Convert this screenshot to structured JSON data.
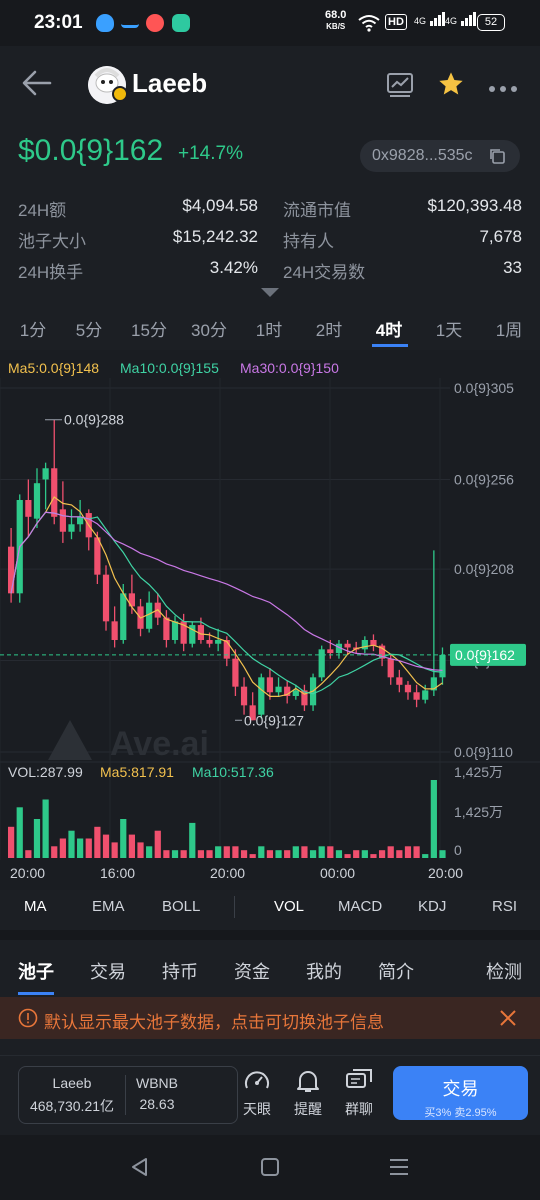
{
  "status": {
    "time": "23:01",
    "net_speed": "68.0",
    "net_unit": "KB/S",
    "hd": "HD",
    "sig1": "4G",
    "sig2": "4G",
    "battery": "52"
  },
  "header": {
    "title": "Laeeb"
  },
  "token": {
    "price": "$0.0{9}162",
    "change": "+14.7%",
    "address": "0x9828...535c"
  },
  "stats": [
    {
      "label": "24H额",
      "value": "$4,094.58"
    },
    {
      "label": "流通市值",
      "value": "$120,393.48"
    },
    {
      "label": "池子大小",
      "value": "$15,242.32"
    },
    {
      "label": "持有人",
      "value": "7,678"
    },
    {
      "label": "24H换手",
      "value": "3.42%"
    },
    {
      "label": "24H交易数",
      "value": "33"
    }
  ],
  "timeframes": [
    "1分",
    "5分",
    "15分",
    "30分",
    "1时",
    "2时",
    "4时",
    "1天",
    "1周"
  ],
  "active_timeframe": "4时",
  "chart": {
    "ma5_label": "Ma5:0.0{9}148",
    "ma10_label": "Ma10:0.0{9}155",
    "ma30_label": "Ma30:0.0{9}150",
    "y_ticks": [
      "0.0{9}305",
      "0.0{9}256",
      "0.0{9}208",
      "0.0{9}159",
      "0.0{9}110"
    ],
    "current_price_tag": "0.0{9}162",
    "high_label": "0.0{9}288",
    "low_label": "0.0{9}127",
    "watermark": "Ave.ai",
    "vol_label": "VOL:287.99",
    "vol_ma5_label": "Ma5:817.91",
    "vol_ma10_label": "Ma10:517.36",
    "vol_ticks": [
      "1,425万",
      "1,425万",
      "0"
    ],
    "x_ticks": [
      "20:00",
      "16:00",
      "20:00",
      "00:00",
      "20:00"
    ]
  },
  "chart_data": {
    "type": "candlestick",
    "y_range": [
      1.1e-10,
      3.05e-10
    ],
    "candles": [
      [
        220,
        195,
        230,
        190
      ],
      [
        195,
        245,
        248,
        190
      ],
      [
        245,
        236,
        256,
        225
      ],
      [
        235,
        254,
        262,
        230
      ],
      [
        256,
        262,
        265,
        240
      ],
      [
        262,
        236,
        288,
        232
      ],
      [
        240,
        228,
        255,
        222
      ],
      [
        228,
        232,
        240,
        224
      ],
      [
        232,
        236,
        245,
        228
      ],
      [
        238,
        225,
        240,
        218
      ],
      [
        225,
        205,
        228,
        200
      ],
      [
        205,
        180,
        210,
        175
      ],
      [
        180,
        170,
        188,
        166
      ],
      [
        170,
        195,
        200,
        168
      ],
      [
        195,
        188,
        205,
        184
      ],
      [
        188,
        176,
        192,
        172
      ],
      [
        176,
        190,
        196,
        174
      ],
      [
        190,
        182,
        195,
        178
      ],
      [
        182,
        170,
        186,
        166
      ],
      [
        170,
        180,
        183,
        168
      ],
      [
        180,
        168,
        184,
        164
      ],
      [
        168,
        178,
        180,
        166
      ],
      [
        178,
        170,
        182,
        168
      ],
      [
        170,
        168,
        174,
        166
      ],
      [
        168,
        170,
        176,
        164
      ],
      [
        170,
        160,
        172,
        156
      ],
      [
        160,
        145,
        165,
        140
      ],
      [
        145,
        135,
        150,
        130
      ],
      [
        135,
        127,
        142,
        127
      ],
      [
        130,
        150,
        152,
        128
      ],
      [
        150,
        142,
        155,
        138
      ],
      [
        142,
        145,
        150,
        140
      ],
      [
        145,
        140,
        148,
        136
      ],
      [
        140,
        143,
        146,
        138
      ],
      [
        143,
        135,
        146,
        132
      ],
      [
        135,
        150,
        152,
        132
      ],
      [
        150,
        165,
        167,
        148
      ],
      [
        165,
        163,
        170,
        160
      ],
      [
        163,
        168,
        170,
        160
      ],
      [
        168,
        166,
        170,
        162
      ],
      [
        166,
        165,
        169,
        163
      ],
      [
        165,
        170,
        172,
        163
      ],
      [
        170,
        167,
        173,
        164
      ],
      [
        167,
        160,
        168,
        156
      ],
      [
        160,
        150,
        162,
        146
      ],
      [
        150,
        146,
        154,
        142
      ],
      [
        146,
        142,
        148,
        138
      ],
      [
        142,
        138,
        146,
        134
      ],
      [
        138,
        143,
        146,
        136
      ],
      [
        143,
        150,
        218,
        140
      ],
      [
        150,
        162,
        166,
        146
      ]
    ],
    "volumes_unit": "万",
    "volume_max": 1425
  },
  "indicators": {
    "main": [
      "MA",
      "EMA",
      "BOLL"
    ],
    "sub": [
      "VOL",
      "MACD",
      "KDJ",
      "RSI"
    ],
    "active_main": "MA",
    "active_sub": "VOL"
  },
  "tabs": {
    "items": [
      "池子",
      "交易",
      "持币",
      "资金",
      "我的",
      "简介"
    ],
    "right": "检测",
    "active": "池子"
  },
  "notice": {
    "text": "默认显示最大池子数据，点击可切换池子信息"
  },
  "pool": {
    "name": "Laeeb",
    "amount": "468,730.21亿",
    "pair": "WBNB",
    "pair_amount": "28.63"
  },
  "actions": [
    {
      "label": "天眼",
      "icon": "gauge-icon"
    },
    {
      "label": "提醒",
      "icon": "bell-icon"
    },
    {
      "label": "群聊",
      "icon": "chat-icon"
    }
  ],
  "trade": {
    "label": "交易",
    "fee": "买3% 卖2.95%"
  },
  "colors": {
    "up": "#2ec98a",
    "down": "#f0506e",
    "ma5": "#f2c14e",
    "ma10": "#3fd3a4",
    "ma30": "#c978e6",
    "accent": "#3b82f6"
  }
}
